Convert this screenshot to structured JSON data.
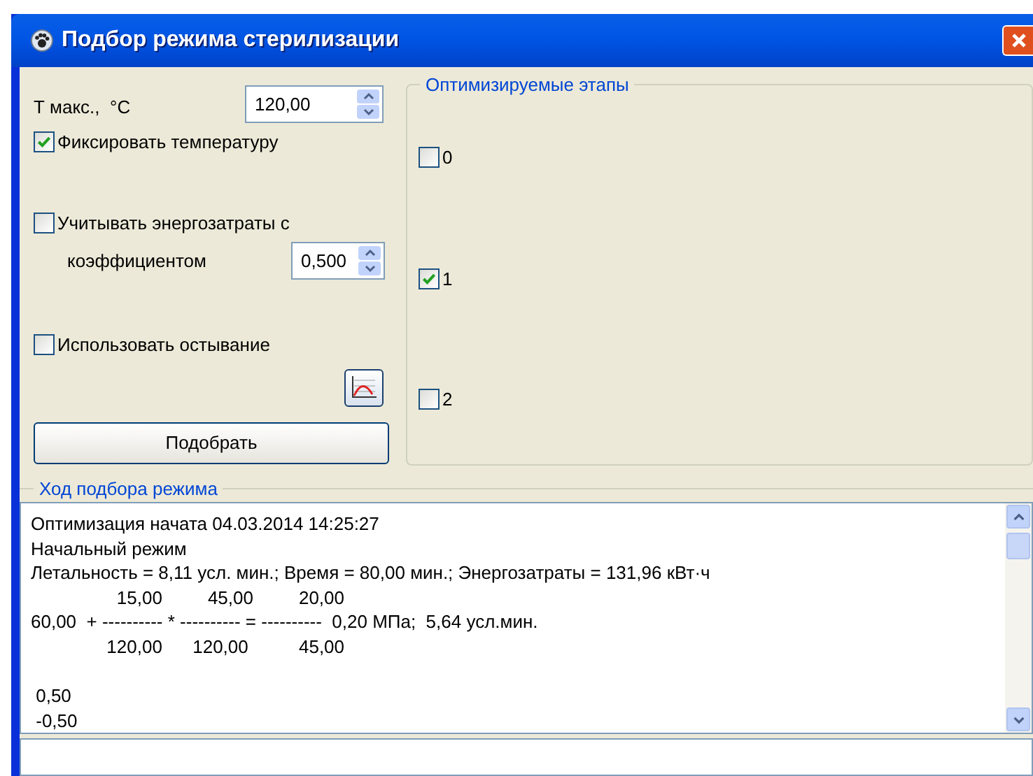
{
  "window": {
    "title": "Подбор режима стерилизации"
  },
  "settings": {
    "t_max": {
      "label": "Т макс.,  °C",
      "value": "120,00"
    },
    "fix_temperature": {
      "label": "Фиксировать температуру",
      "checked": true
    },
    "energy": {
      "label": "Учитывать энергозатраты с",
      "checked": false,
      "coefficient_label": "коэффициентом",
      "coefficient": "0,500"
    },
    "cooling": {
      "label": "Использовать остывание",
      "checked": false
    },
    "select_button": "Подобрать"
  },
  "stages": {
    "title": "Оптимизируемые этапы",
    "items": [
      {
        "label": "0",
        "checked": false
      },
      {
        "label": "1",
        "checked": true
      },
      {
        "label": "2",
        "checked": false
      }
    ]
  },
  "progress": {
    "title": "Ход подбора режима",
    "blocks": [
      [
        "Оптимизация начата 04.03.2014 14:25:27",
        "Начальный режим",
        "Летальность = 8,11 усл. мин.; Время = 80,00 мин.; Энергозатраты = 131,96 кВт·ч",
        "                 15,00         45,00         20,00",
        "60,00  + ---------- * ---------- = ----------  0,20 МПа;  5,64 усл.мин.",
        "               120,00      120,00          45,00"
      ],
      [
        " 0,50",
        " -0,50"
      ]
    ]
  }
}
